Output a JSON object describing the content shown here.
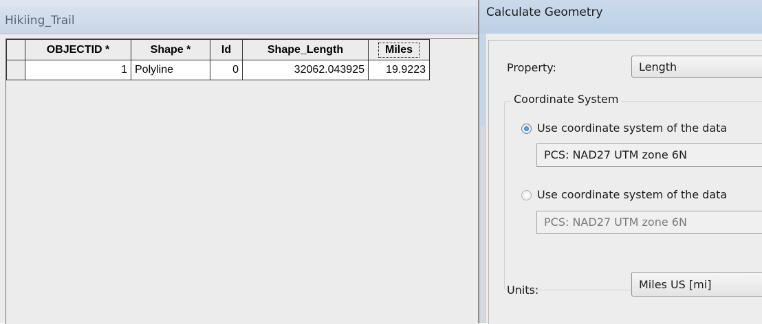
{
  "table": {
    "title": "Hikiing_Trail",
    "columns": [
      "OBJECTID *",
      "Shape *",
      "Id",
      "Shape_Length",
      "Miles"
    ],
    "rows": [
      {
        "objectid": "1",
        "shape": "Polyline",
        "id": "0",
        "shape_length": "32062.043925",
        "miles": "19.9223"
      }
    ]
  },
  "dialog": {
    "title": "Calculate Geometry",
    "property_label": "Property:",
    "property_value": "Length",
    "coord_group_label": "Coordinate System",
    "option1_label": "Use coordinate system of the data",
    "option1_value": "PCS: NAD27 UTM zone 6N",
    "option1_selected": true,
    "option2_label": "Use coordinate system of the data",
    "option2_value": "PCS: NAD27 UTM zone 6N",
    "option2_selected": false,
    "units_label": "Units:",
    "units_value": "Miles US [mi]"
  }
}
